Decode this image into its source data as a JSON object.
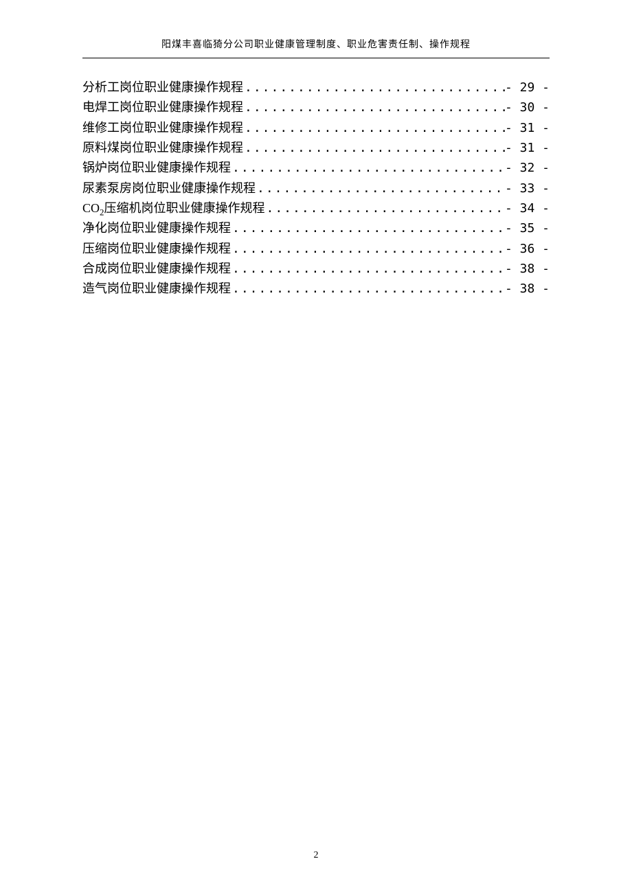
{
  "header": {
    "title": "阳煤丰喜临猗分公司职业健康管理制度、职业危害责任制、操作规程"
  },
  "toc": {
    "entries": [
      {
        "title": "分析工岗位职业健康操作规程",
        "page": "- 29 -"
      },
      {
        "title": "电焊工岗位职业健康操作规程",
        "page": "- 30 -"
      },
      {
        "title": "维修工岗位职业健康操作规程",
        "page": "- 31 -"
      },
      {
        "title": "原料煤岗位职业健康操作规程",
        "page": "- 31 -"
      },
      {
        "title": "锅炉岗位职业健康操作规程",
        "page": "- 32 -"
      },
      {
        "title": "尿素泵房岗位职业健康操作规程",
        "page": "- 33 -"
      },
      {
        "title_prefix": "CO",
        "title_sub": "2",
        "title_suffix": "压缩机岗位职业健康操作规程",
        "page": "- 34 -"
      },
      {
        "title": "净化岗位职业健康操作规程",
        "page": "- 35 -"
      },
      {
        "title": "压缩岗位职业健康操作规程",
        "page": "- 36 -"
      },
      {
        "title": "合成岗位职业健康操作规程",
        "page": "- 38 -"
      },
      {
        "title": "造气岗位职业健康操作规程",
        "page": "- 38 -"
      }
    ]
  },
  "footer": {
    "page_number": "2"
  }
}
